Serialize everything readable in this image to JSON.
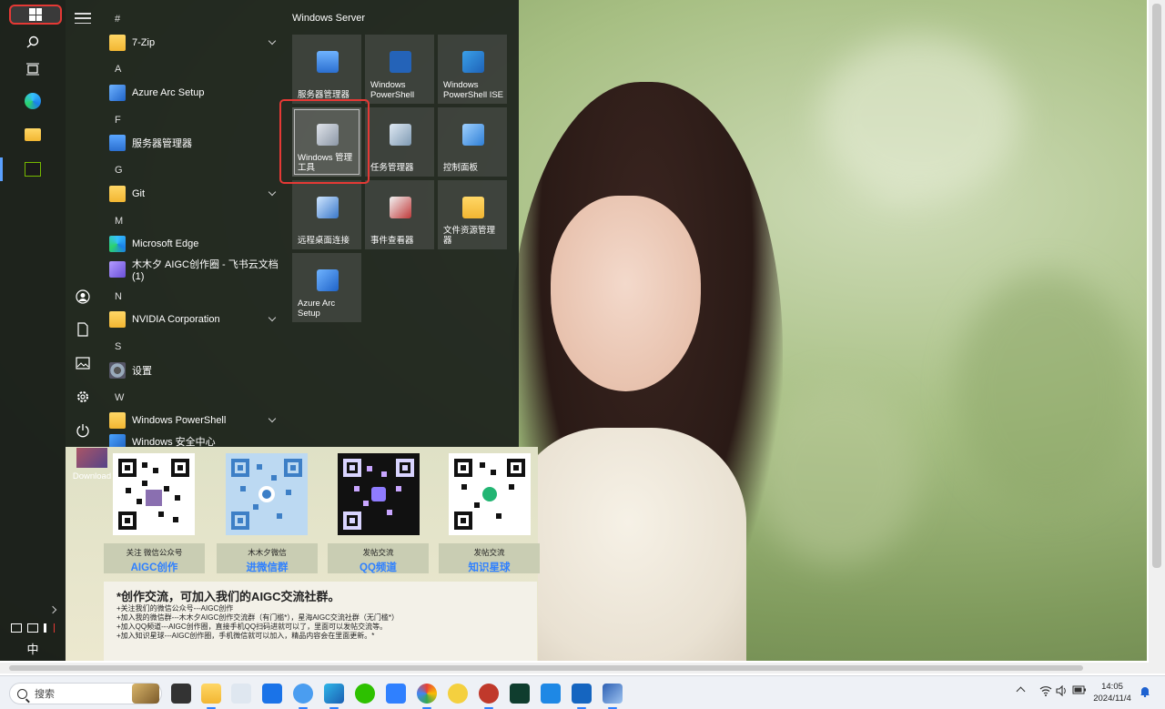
{
  "start_rail": {
    "ime": "中"
  },
  "app_list": {
    "groups": [
      {
        "letter": "#"
      },
      {
        "letter": "A"
      },
      {
        "letter": "F"
      },
      {
        "letter": "G"
      },
      {
        "letter": "M"
      },
      {
        "letter": "N"
      },
      {
        "letter": "S"
      },
      {
        "letter": "W"
      }
    ],
    "apps": [
      {
        "label": "7-Zip",
        "icon": "folder-icon",
        "expandable": true
      },
      {
        "label": "Azure Arc Setup",
        "icon": "azure-arc-icon",
        "expandable": false
      },
      {
        "label": "服务器管理器",
        "icon": "server-manager-icon",
        "expandable": false
      },
      {
        "label": "Git",
        "icon": "folder-icon",
        "expandable": true
      },
      {
        "label": "Microsoft Edge",
        "icon": "edge-icon",
        "expandable": false
      },
      {
        "label": "木木夕 AIGC创作圈 - 飞书云文档 (1)",
        "icon": "doc-icon",
        "expandable": false
      },
      {
        "label": "NVIDIA Corporation",
        "icon": "folder-icon",
        "expandable": true
      },
      {
        "label": "设置",
        "icon": "gear-icon",
        "expandable": false
      },
      {
        "label": "Windows PowerShell",
        "icon": "folder-icon",
        "expandable": true
      },
      {
        "label": "Windows 安全中心",
        "icon": "shield-icon",
        "expandable": false
      }
    ]
  },
  "tiles": {
    "header": "Windows Server",
    "items": [
      {
        "label": "服务器管理器"
      },
      {
        "label": "Windows PowerShell"
      },
      {
        "label": "Windows PowerShell ISE"
      },
      {
        "label": "Windows 管理工具"
      },
      {
        "label": "任务管理器"
      },
      {
        "label": "控制面板"
      },
      {
        "label": "远程桌面连接"
      },
      {
        "label": "事件查看器"
      },
      {
        "label": "文件资源管理器"
      },
      {
        "label": "Azure Arc Setup"
      }
    ]
  },
  "desktop": {
    "icon_label": "Download"
  },
  "poster": {
    "captions": [
      {
        "line1": "关注 微信公众号",
        "line2": "AIGC创作"
      },
      {
        "line1": "木木夕微信",
        "line2": "进微信群"
      },
      {
        "line1": "发帖交流",
        "line2": "QQ频道"
      },
      {
        "line1": "发帖交流",
        "line2": "知识星球"
      }
    ],
    "note_title": "*创作交流，可加入我们的AIGC交流社群。",
    "note_lines": [
      "+关注我们的微信公众号---AIGC创作",
      "+加入我的微信群---木木夕AIGC创作交流群（有门槛*），星海AIGC交流社群（无门槛*）",
      "+加入QQ频道---AIGC创作圈，直接手机QQ扫码进就可以了，里面可以发帖交流等。",
      "+加入知识星球---AIGC创作圈，手机微信就可以加入，精品内容会在里面更新。*"
    ]
  },
  "taskbar": {
    "search_placeholder": "搜索",
    "time": "14:05",
    "date": "2024/11/4"
  },
  "colors": {
    "highlight": "#e53935",
    "accent": "#2f80ff"
  }
}
